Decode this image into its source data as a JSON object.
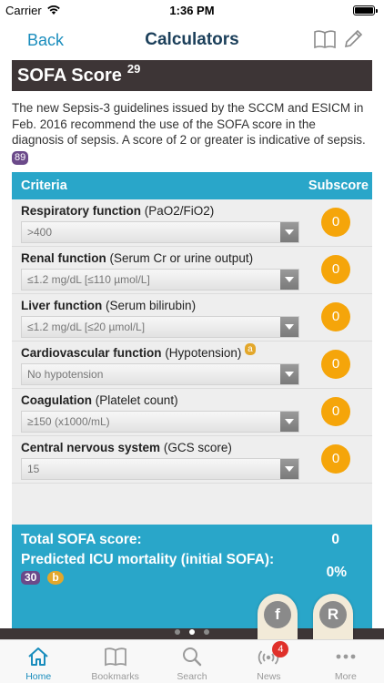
{
  "status_bar": {
    "carrier": "Carrier",
    "time": "1:36 PM"
  },
  "nav": {
    "back_label": "Back",
    "title": "Calculators"
  },
  "calculator": {
    "title": "SOFA Score",
    "title_ref": "29",
    "intro": "The new Sepsis-3 guidelines issued by the SCCM and ESICM in Feb. 2016 recommend the use of the SOFA score in the diagnosis of sepsis. A score of 2 or greater is indicative of sepsis.",
    "intro_ref": "89",
    "table_headers": {
      "criteria": "Criteria",
      "subscore": "Subscore"
    },
    "rows": [
      {
        "name": "Respiratory function",
        "detail": "(PaO2/FiO2)",
        "ref": "",
        "selected": ">400",
        "subscore": "0"
      },
      {
        "name": "Renal function",
        "detail": "(Serum Cr or urine output)",
        "ref": "",
        "selected": "≤1.2 mg/dL [≤110 µmol/L]",
        "subscore": "0"
      },
      {
        "name": "Liver function",
        "detail": "(Serum bilirubin)",
        "ref": "",
        "selected": "≤1.2 mg/dL [≤20 µmol/L]",
        "subscore": "0"
      },
      {
        "name": "Cardiovascular function",
        "detail": "(Hypotension)",
        "ref": "a",
        "selected": "No hypotension",
        "subscore": "0"
      },
      {
        "name": "Coagulation",
        "detail": "(Platelet count)",
        "ref": "",
        "selected": "≥150 (x1000/mL)",
        "subscore": "0"
      },
      {
        "name": "Central nervous system",
        "detail": "(GCS score)",
        "ref": "",
        "selected": "15",
        "subscore": "0"
      }
    ],
    "total_label": "Total SOFA score:",
    "total_value": "0",
    "mortality_label": "Predicted ICU mortality (initial SOFA):",
    "mortality_value": "0%",
    "mortality_refs": [
      "30",
      "b"
    ]
  },
  "floating_buttons": {
    "facebook": "f",
    "r": "R"
  },
  "pager": {
    "count": 3,
    "active": 1
  },
  "tab_bar": {
    "tabs": [
      {
        "label": "Home",
        "icon": "home-icon"
      },
      {
        "label": "Bookmarks",
        "icon": "bookmarks-icon"
      },
      {
        "label": "Search",
        "icon": "search-icon"
      },
      {
        "label": "News",
        "icon": "news-icon",
        "badge": "4"
      },
      {
        "label": "More",
        "icon": "more-icon"
      }
    ]
  },
  "colors": {
    "accent": "#1a8dbd",
    "table_header": "#29a6c9",
    "score_header": "#3d3536",
    "subscore": "#f5a50a"
  }
}
